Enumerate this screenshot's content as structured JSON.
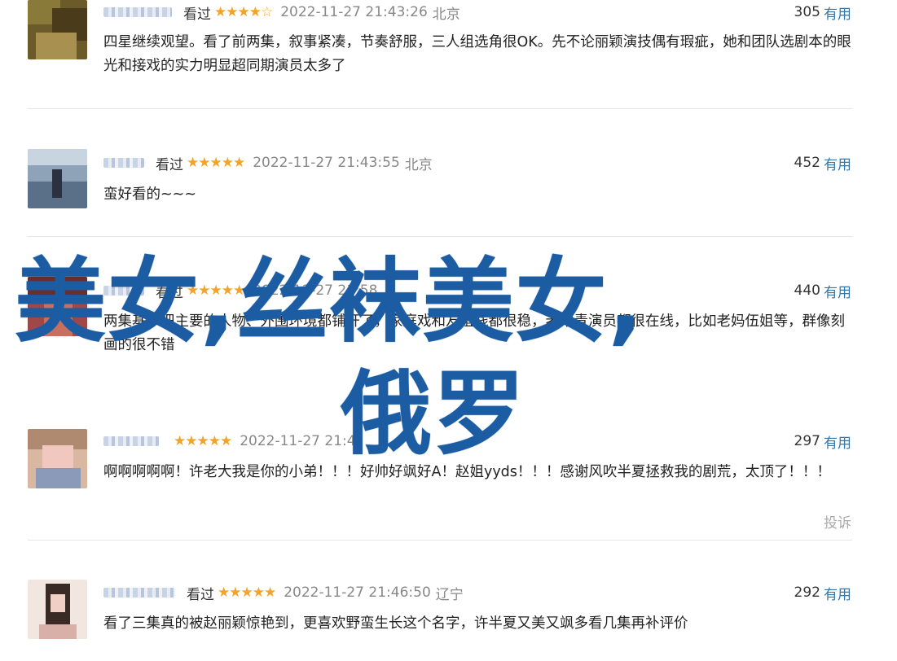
{
  "reviews": [
    {
      "status": "看过",
      "stars": "★★★★☆",
      "time": "2022-11-27 21:43:26",
      "location": "北京",
      "useful_count": "305",
      "useful_label": "有用",
      "text": "四星继续观望。看了前两集，叙事紧凑，节奏舒服，三人组选角很OK。先不论丽颖演技偶有瑕疵，她和团队选剧本的眼光和接戏的实力明显超同期演员太多了"
    },
    {
      "status": "看过",
      "stars": "★★★★★",
      "time": "2022-11-27 21:43:55",
      "location": "北京",
      "useful_count": "452",
      "useful_label": "有用",
      "text": "蛮好看的~~~"
    },
    {
      "status": "看过",
      "stars": "★★★★★",
      "time": "2022-11-27 21:58",
      "location": "",
      "useful_count": "440",
      "useful_label": "有用",
      "text": "两集基本把主要的人物、外围环境都铺开了，家庭戏和友谊线都很稳，老中青演员都很在线，比如老妈伍姐等，群像刻画的很不错"
    },
    {
      "status": "",
      "stars": "★★★★★",
      "time": "2022-11-27 21:4",
      "location": "",
      "useful_count": "297",
      "useful_label": "有用",
      "text": "啊啊啊啊啊！许老大我是你的小弟！！！好帅好飒好A！赵姐yyds！！！感谢风吹半夏拯救我的剧荒，太顶了！！！",
      "report_label": "投诉"
    },
    {
      "status": "看过",
      "stars": "★★★★★",
      "time": "2022-11-27 21:46:50",
      "location": "辽宁",
      "useful_count": "292",
      "useful_label": "有用",
      "text": "看了三集真的被赵丽颖惊艳到，更喜欢野蛮生长这个名字，许半夏又美又飒多看几集再补评价"
    }
  ],
  "overlay": {
    "line1": "美女,丝袜美女,",
    "line2": "俄罗"
  },
  "colors": {
    "overlay_blue": "#1b5ca3",
    "star": "#f2a42a",
    "link": "#3377aa"
  }
}
